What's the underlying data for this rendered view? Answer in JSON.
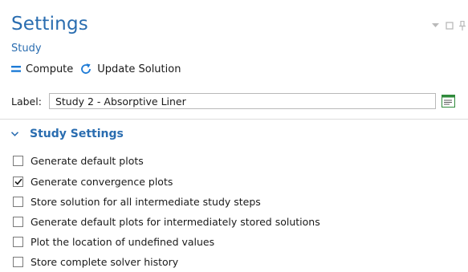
{
  "header": {
    "title": "Settings",
    "subtitle": "Study"
  },
  "toolbar": {
    "compute_label": "Compute",
    "update_label": "Update Solution"
  },
  "label_field": {
    "label": "Label:",
    "value": "Study 2 - Absorptive Liner"
  },
  "section": {
    "title": "Study Settings",
    "expanded": true,
    "options": [
      {
        "label": "Generate default plots",
        "checked": false
      },
      {
        "label": "Generate convergence plots",
        "checked": true
      },
      {
        "label": "Store solution for all intermediate study steps",
        "checked": false
      },
      {
        "label": "Generate default plots for intermediately stored solutions",
        "checked": false
      },
      {
        "label": "Plot the location of undefined values",
        "checked": false
      },
      {
        "label": "Store complete solver history",
        "checked": false
      }
    ]
  },
  "colors": {
    "accent": "#2a6db0",
    "compute_icon": "#1e7bd6",
    "text": "#1a1a1a"
  },
  "icons": [
    "dropdown-arrow-icon",
    "restore-icon",
    "pin-icon",
    "compute-icon",
    "update-solution-icon",
    "form-icon",
    "chevron-down-icon",
    "checkmark-icon"
  ]
}
